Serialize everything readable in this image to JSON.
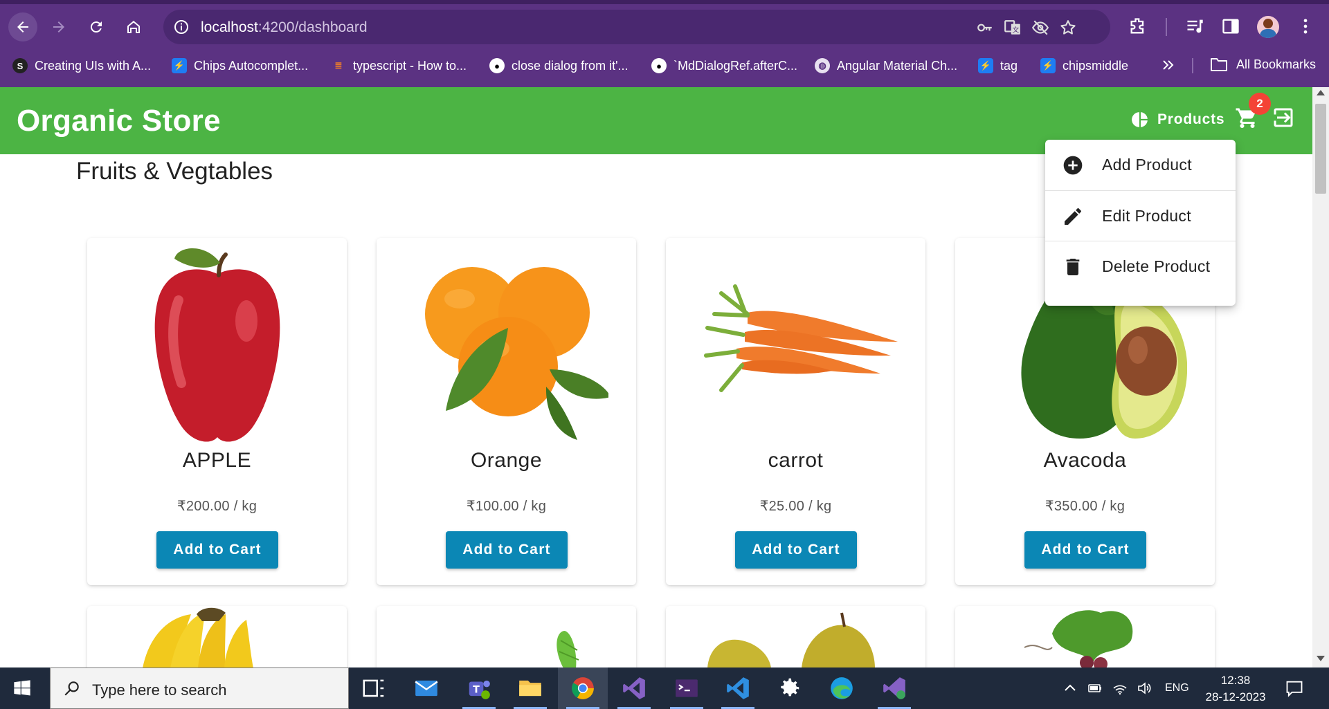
{
  "browser": {
    "url_host": "localhost",
    "url_path": ":4200/dashboard",
    "bookmarks": [
      {
        "label": "Creating UIs with A...",
        "icon": "dark-logo-icon"
      },
      {
        "label": "Chips Autocomplet...",
        "icon": "stackblitz-icon"
      },
      {
        "label": "typescript - How to...",
        "icon": "stackoverflow-icon"
      },
      {
        "label": "close dialog from it'...",
        "icon": "github-icon"
      },
      {
        "label": "`MdDialogRef.afterC...",
        "icon": "github-icon"
      },
      {
        "label": "Angular Material Ch...",
        "icon": "globe-icon"
      },
      {
        "label": "tag",
        "icon": "stackblitz-icon"
      },
      {
        "label": "chipsmiddle",
        "icon": "stackblitz-icon"
      }
    ],
    "all_bookmarks_label": "All Bookmarks"
  },
  "app": {
    "brand": "Organic Store",
    "nav_products": "Products",
    "cart_count": "2",
    "section_title": "Fruits & Vegtables",
    "add_to_cart": "Add to Cart",
    "products": [
      {
        "name": "APPLE",
        "price": "₹200.00 / kg"
      },
      {
        "name": "Orange",
        "price": "₹100.00 / kg"
      },
      {
        "name": "carrot",
        "price": "₹25.00 / kg"
      },
      {
        "name": "Avacoda",
        "price": "₹350.00 / kg"
      }
    ],
    "menu": [
      {
        "label": "Add Product",
        "icon": "add-circle-icon"
      },
      {
        "label": "Edit Product",
        "icon": "pencil-icon"
      },
      {
        "label": "Delete Product",
        "icon": "trash-icon"
      }
    ],
    "colors": {
      "appbar": "#4cb444",
      "button": "#0b87b5",
      "badge": "#f44336",
      "browser": "#5b3282"
    }
  },
  "taskbar": {
    "search_placeholder": "Type here to search",
    "language": "ENG",
    "time": "12:38",
    "date": "28-12-2023"
  }
}
